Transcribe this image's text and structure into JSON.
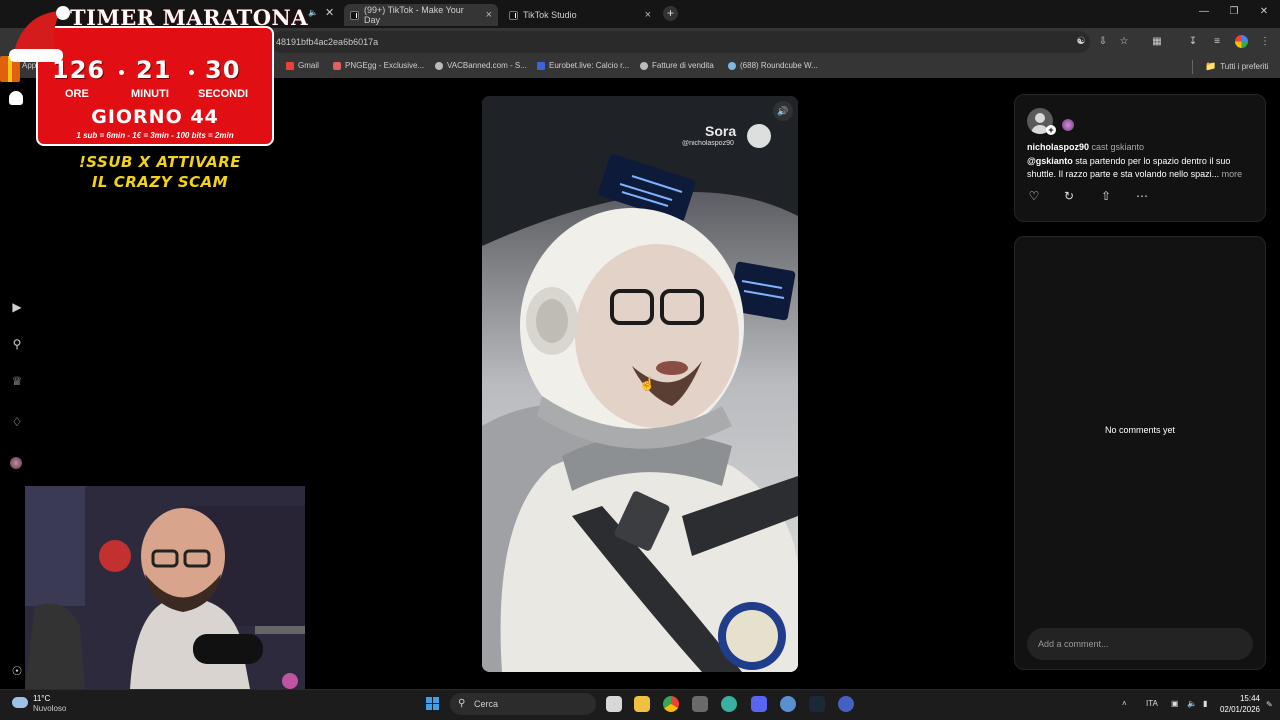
{
  "browser": {
    "tabs": [
      {
        "label": "(99+) TikTok - Make Your Day",
        "active": true
      },
      {
        "label": "TikTok Studio",
        "active": false
      }
    ],
    "url": "48191bfb4ac2ea6b6017a",
    "bookmarks": [
      {
        "label": "App",
        "icon": "apps-icon"
      },
      {
        "label": "Gmail",
        "icon": "gmail-icon",
        "color": "#ea4335"
      },
      {
        "label": "PNGEgg - Exclusive...",
        "icon": "pngegg-icon",
        "color": "#e0605a"
      },
      {
        "label": "VACBanned.com - S...",
        "icon": "vacbanned-icon",
        "color": "#bbbbbb"
      },
      {
        "label": "Eurobet.live: Calcio r...",
        "icon": "eurobet-icon",
        "color": "#3a64d8"
      },
      {
        "label": "Fatture di vendita",
        "icon": "fatture-icon",
        "color": "#bbbbbb"
      },
      {
        "label": "(688) Roundcube W...",
        "icon": "roundcube-icon",
        "color": "#7fb8e0"
      }
    ],
    "all_bookmarks_label": "Tutti i preferiti"
  },
  "timer": {
    "title": "TIMER MARATONA",
    "hours": "126",
    "minutes": "21",
    "seconds": "30",
    "hours_label": "ORE",
    "minutes_label": "MINUTI",
    "seconds_label": "SECONDI",
    "day": "GIORNO 44",
    "rates": "1 sub = 6min - 1€ = 3min - 100 bits = 2min"
  },
  "promo_text": "!SSUB X ATTIVARE IL CRAZY SCAM",
  "video": {
    "watermark_label": "Sora",
    "watermark_handle": "@nicholaspoz90"
  },
  "post": {
    "username": "nicholaspoz90",
    "cast_label": "cast gskianto",
    "mention": "@gskianto",
    "description": " sta partendo per lo spazio dentro il suo shuttle. Il razzo parte e sta volando nello spazi...",
    "more_label": "more"
  },
  "comments": {
    "empty_label": "No comments yet",
    "input_placeholder": "Add a comment..."
  },
  "taskbar": {
    "temperature": "11°C",
    "weather": "Nuvoloso",
    "search_label": "Cerca",
    "language": "ITA",
    "time": "15:44",
    "date": "02/01/2026"
  },
  "colors": {
    "timer_red": "#e10f14",
    "promo_yellow": "#f2d21a"
  }
}
